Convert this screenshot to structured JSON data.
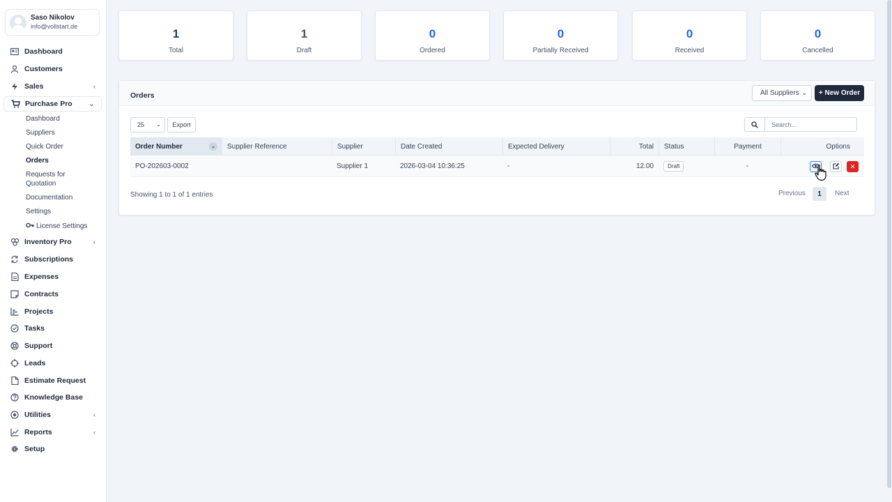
{
  "user": {
    "name": "Saso Nikolov",
    "email": "info@vollstart.de"
  },
  "nav": [
    {
      "label": "Dashboard",
      "icon": "dashboard-icon"
    },
    {
      "label": "Customers",
      "icon": "user-icon"
    },
    {
      "label": "Sales",
      "icon": "bolt-icon",
      "chevron": "‹"
    },
    {
      "label": "Purchase Pro",
      "icon": "cart-icon",
      "chevron": "⌄"
    },
    {
      "label": "Inventory Pro",
      "icon": "boxes-icon",
      "chevron": "‹"
    },
    {
      "label": "Subscriptions",
      "icon": "repeat-icon"
    },
    {
      "label": "Expenses",
      "icon": "document-icon"
    },
    {
      "label": "Contracts",
      "icon": "contract-icon"
    },
    {
      "label": "Projects",
      "icon": "chart-icon"
    },
    {
      "label": "Tasks",
      "icon": "check-circle-icon"
    },
    {
      "label": "Support",
      "icon": "lifebuoy-icon"
    },
    {
      "label": "Leads",
      "icon": "crosshair-icon"
    },
    {
      "label": "Estimate Request",
      "icon": "file-icon"
    },
    {
      "label": "Knowledge Base",
      "icon": "question-icon"
    },
    {
      "label": "Utilities",
      "icon": "circle-dot-icon",
      "chevron": "‹"
    },
    {
      "label": "Reports",
      "icon": "line-chart-icon",
      "chevron": "‹"
    },
    {
      "label": "Setup",
      "icon": "gear-icon"
    }
  ],
  "purchase_sub": [
    {
      "label": "Dashboard"
    },
    {
      "label": "Suppliers"
    },
    {
      "label": "Quick Order"
    },
    {
      "label": "Orders"
    },
    {
      "label": "Requests for"
    },
    {
      "label": "Quotation"
    },
    {
      "label": "Documentation"
    },
    {
      "label": "Settings"
    },
    {
      "label": "License Settings"
    }
  ],
  "stats": [
    {
      "value": "1",
      "label": "Total",
      "color": "#1e3a5f"
    },
    {
      "value": "1",
      "label": "Draft",
      "color": "#475569"
    },
    {
      "value": "0",
      "label": "Ordered",
      "color": "#2563eb"
    },
    {
      "value": "0",
      "label": "Partially Received",
      "color": "#2563eb"
    },
    {
      "value": "0",
      "label": "Received",
      "color": "#2563eb"
    },
    {
      "value": "0",
      "label": "Cancelled",
      "color": "#2563eb"
    }
  ],
  "orders": {
    "title": "Orders",
    "supplier_filter": "All Suppliers",
    "new_order": "+ New Order",
    "page_length": "25",
    "export": "Export",
    "search_placeholder": "Search...",
    "columns": [
      "Order Number",
      "Supplier Reference",
      "Supplier",
      "Date Created",
      "Expected Delivery",
      "Total",
      "Status",
      "Payment",
      "Options"
    ],
    "rows": [
      {
        "order_number": "PO-202603-0002",
        "supplier_reference": "",
        "supplier": "Supplier 1",
        "date_created": "2026-03-04 10:36:25",
        "expected_delivery": "-",
        "total": "12.00",
        "status": "Draft",
        "payment": "-"
      }
    ],
    "info": "Showing 1 to 1 of 1 entries",
    "previous": "Previous",
    "page": "1",
    "next": "Next"
  }
}
